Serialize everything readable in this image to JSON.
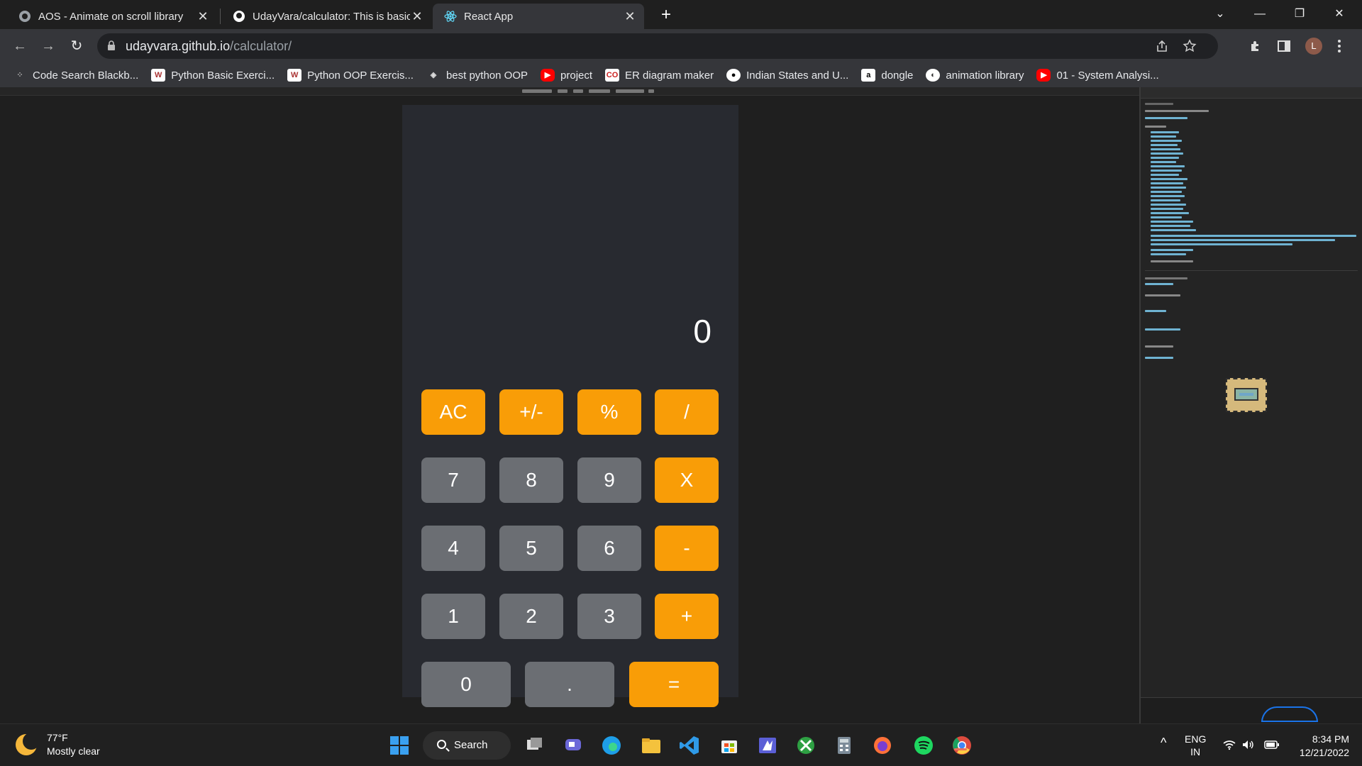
{
  "tabs": [
    {
      "title": "AOS - Animate on scroll library",
      "close": "✕"
    },
    {
      "title": "UdayVara/calculator: This is basic",
      "close": "✕"
    },
    {
      "title": "React App",
      "close": "✕"
    }
  ],
  "new_tab": "+",
  "window": {
    "chevron": "⌄",
    "minimize": "—",
    "restore": "❐",
    "close": "✕"
  },
  "toolbar": {
    "back": "←",
    "forward": "→",
    "reload": "↻",
    "url_host": "udayvara.github.io",
    "url_path": "/calculator/",
    "profile_initial": "L"
  },
  "bookmarks": [
    {
      "label": "Code Search Blackb...",
      "icon": "dots-icon",
      "color": "#555555"
    },
    {
      "label": "Python Basic Exerci...",
      "icon": "w3resource-icon",
      "color": "#ffffff"
    },
    {
      "label": "Python OOP Exercis...",
      "icon": "w3resource-icon",
      "color": "#ffffff"
    },
    {
      "label": "best python OOP",
      "icon": "compass-icon",
      "color": "#444444"
    },
    {
      "label": "project",
      "icon": "youtube-icon",
      "color": "#ff0000"
    },
    {
      "label": "ER diagram maker",
      "icon": "creately-icon",
      "color": "#ffffff"
    },
    {
      "label": "Indian States and U...",
      "icon": "github-icon",
      "color": "#ffffff"
    },
    {
      "label": "dongle",
      "icon": "amazon-icon",
      "color": "#ffffff"
    },
    {
      "label": "animation library",
      "icon": "globe-icon",
      "color": "#ffffff"
    },
    {
      "label": "01 - System Analysi...",
      "icon": "youtube-icon",
      "color": "#ff0000"
    }
  ],
  "calculator": {
    "display": "0",
    "buttons": {
      "ac": "AC",
      "sign": "+/-",
      "percent": "%",
      "divide": "/",
      "seven": "7",
      "eight": "8",
      "nine": "9",
      "multiply": "X",
      "four": "4",
      "five": "5",
      "six": "6",
      "minus": "-",
      "one": "1",
      "two": "2",
      "three": "3",
      "plus": "+",
      "zero": "0",
      "dot": ".",
      "equals": "="
    },
    "colors": {
      "operator": "#f99d07",
      "number": "#6b6e73",
      "body": "#282a30"
    }
  },
  "taskbar": {
    "temperature": "77°F",
    "condition": "Mostly clear",
    "search_label": "Search",
    "lang_top": "ENG",
    "lang_bottom": "IN",
    "time": "8:34 PM",
    "date": "12/21/2022",
    "chevron": "^"
  }
}
